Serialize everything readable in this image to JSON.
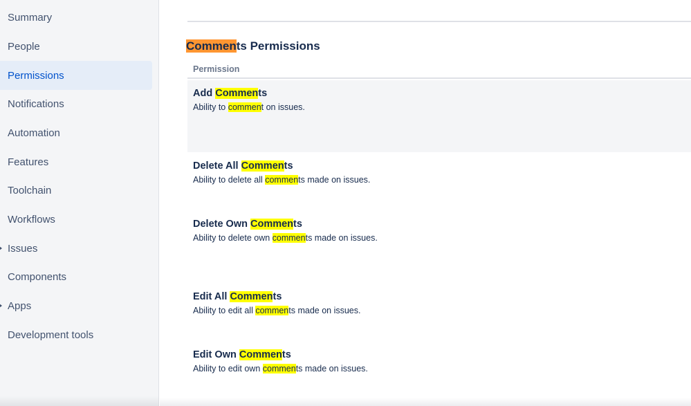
{
  "sidebar": {
    "items": [
      {
        "label": "Summary",
        "active": false,
        "expandable": false
      },
      {
        "label": "People",
        "active": false,
        "expandable": false
      },
      {
        "label": "Permissions",
        "active": true,
        "expandable": false
      },
      {
        "label": "Notifications",
        "active": false,
        "expandable": false
      },
      {
        "label": "Automation",
        "active": false,
        "expandable": false
      },
      {
        "label": "Features",
        "active": false,
        "expandable": false
      },
      {
        "label": "Toolchain",
        "active": false,
        "expandable": false
      },
      {
        "label": "Workflows",
        "active": false,
        "expandable": false
      },
      {
        "label": "Issues",
        "active": false,
        "expandable": true
      },
      {
        "label": "Components",
        "active": false,
        "expandable": false
      },
      {
        "label": "Apps",
        "active": false,
        "expandable": true
      },
      {
        "label": "Development tools",
        "active": false,
        "expandable": false
      }
    ]
  },
  "search_highlight": {
    "term": "Commen",
    "current_match_color": "#ff9632",
    "match_color": "#ffff00"
  },
  "section": {
    "title_match": "Commen",
    "title_rest": "ts Permissions",
    "column_header": "Permission"
  },
  "permissions": [
    {
      "name_pre": "Add ",
      "name_match": "Commen",
      "name_post": "ts",
      "desc_pre": "Ability to ",
      "desc_match": "commen",
      "desc_post": "t on issues.",
      "hovered": true
    },
    {
      "name_pre": "Delete All ",
      "name_match": "Commen",
      "name_post": "ts",
      "desc_pre": "Ability to delete all ",
      "desc_match": "commen",
      "desc_post": "ts made on issues.",
      "hovered": false
    },
    {
      "name_pre": "Delete Own ",
      "name_match": "Commen",
      "name_post": "ts",
      "desc_pre": "Ability to delete own ",
      "desc_match": "commen",
      "desc_post": "ts made on issues.",
      "hovered": false
    },
    {
      "name_pre": "Edit All ",
      "name_match": "Commen",
      "name_post": "ts",
      "desc_pre": "Ability to edit all ",
      "desc_match": "commen",
      "desc_post": "ts made on issues.",
      "hovered": false
    },
    {
      "name_pre": "Edit Own ",
      "name_match": "Commen",
      "name_post": "ts",
      "desc_pre": "Ability to edit own ",
      "desc_match": "commen",
      "desc_post": "ts made on issues.",
      "hovered": false
    }
  ]
}
